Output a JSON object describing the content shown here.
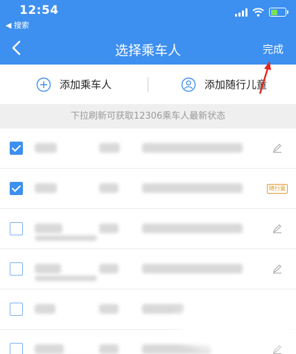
{
  "status_bar": {
    "time": "12:54",
    "back_app": "◀ 搜索"
  },
  "nav": {
    "title": "选择乘车人",
    "done": "完成"
  },
  "add_bar": {
    "add_passenger": "添加乘车人",
    "add_child": "添加随行儿童"
  },
  "hint": "下拉刷新可获取12306乘车人最新状态",
  "passengers": [
    {
      "checked": true,
      "action": "edit"
    },
    {
      "checked": true,
      "action": "tag",
      "tag": "随行童"
    },
    {
      "checked": false,
      "action": "edit"
    },
    {
      "checked": false,
      "action": "edit"
    },
    {
      "checked": false,
      "action": "none"
    },
    {
      "checked": false,
      "action": "edit"
    }
  ],
  "colors": {
    "brand": "#3d8ff0",
    "hint_bg": "#efefef",
    "tag": "#e09a2c",
    "annotation_arrow": "#e0281e"
  },
  "icons": [
    "back-arrow-icon",
    "wifi-icon",
    "battery-icon",
    "add-circle-icon",
    "child-user-icon",
    "edit-pencil-icon",
    "checkbox-icon"
  ]
}
